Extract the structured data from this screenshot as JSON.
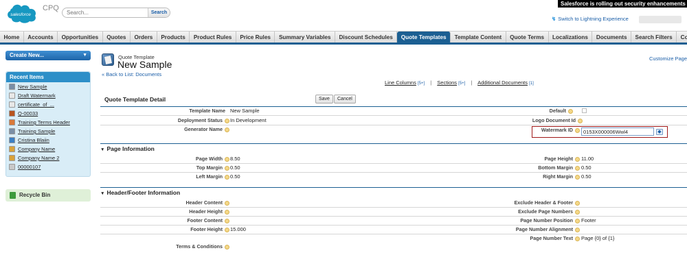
{
  "header": {
    "logo_text": "salesforce",
    "app_name": "CPQ",
    "search_placeholder": "Search...",
    "search_button": "Search",
    "banner": "Salesforce is rolling out security enhancements that",
    "lightning_link": "Switch to Lightning Experience"
  },
  "tabs": [
    {
      "label": "Home",
      "active": false
    },
    {
      "label": "Accounts",
      "active": false
    },
    {
      "label": "Opportunities",
      "active": false
    },
    {
      "label": "Quotes",
      "active": false
    },
    {
      "label": "Orders",
      "active": false
    },
    {
      "label": "Products",
      "active": false
    },
    {
      "label": "Product Rules",
      "active": false
    },
    {
      "label": "Price Rules",
      "active": false
    },
    {
      "label": "Summary Variables",
      "active": false
    },
    {
      "label": "Discount Schedules",
      "active": false
    },
    {
      "label": "Quote Templates",
      "active": true
    },
    {
      "label": "Template Content",
      "active": false
    },
    {
      "label": "Quote Terms",
      "active": false
    },
    {
      "label": "Localizations",
      "active": false
    },
    {
      "label": "Documents",
      "active": false
    },
    {
      "label": "Search Filters",
      "active": false
    },
    {
      "label": "Co",
      "active": false
    }
  ],
  "sidebar": {
    "create_new": "Create New...",
    "recent_title": "Recent Items",
    "recent_items": [
      {
        "label": "New Sample",
        "icon": "template-icon",
        "color": "#7a8fa6"
      },
      {
        "label": "Draft Watermark",
        "icon": "document-icon",
        "color": "#e8e8e8"
      },
      {
        "label": "certificate_of_...",
        "icon": "document-icon",
        "color": "#e8e8e8"
      },
      {
        "label": "Q-00033",
        "icon": "quote-icon",
        "color": "#b8541e"
      },
      {
        "label": "Training Terms Header",
        "icon": "template-content-icon",
        "color": "#d97a3a"
      },
      {
        "label": "Training Sample",
        "icon": "template-icon",
        "color": "#7a8fa6"
      },
      {
        "label": "Cristina Blaiin",
        "icon": "contact-icon",
        "color": "#3b7fc4"
      },
      {
        "label": "Company Name",
        "icon": "template-content-icon",
        "color": "#d9a23a"
      },
      {
        "label": "Company Name 2",
        "icon": "template-content-icon",
        "color": "#d9a23a"
      },
      {
        "label": "00000107",
        "icon": "document-icon",
        "color": "#c9c9c9"
      }
    ],
    "recycle_bin": "Recycle Bin"
  },
  "page": {
    "object_type": "Quote Template",
    "title": "New Sample",
    "back_link": "« Back to List: Documents",
    "customize": "Customize Page",
    "related_links": [
      {
        "label": "Line Columns",
        "count": "[5+]"
      },
      {
        "label": "Sections",
        "count": "[5+]"
      },
      {
        "label": "Additional Documents",
        "count": "[1]"
      }
    ]
  },
  "detail": {
    "title": "Quote Template Detail",
    "save": "Save",
    "cancel": "Cancel",
    "fields": {
      "template_name_label": "Template Name",
      "template_name_value": "New Sample",
      "deployment_status_label": "Deployment Status",
      "deployment_status_value": "In Development",
      "generator_name_label": "Generator Name",
      "default_label": "Default",
      "logo_document_label": "Logo Document Id",
      "watermark_label": "Watermark ID",
      "watermark_value": "0153X000006Wwl4"
    }
  },
  "page_information": {
    "title": "Page Information",
    "page_width_label": "Page Width",
    "page_width_value": "8.50",
    "page_height_label": "Page Height",
    "page_height_value": "11.00",
    "top_margin_label": "Top Margin",
    "top_margin_value": "0.50",
    "bottom_margin_label": "Bottom Margin",
    "bottom_margin_value": "0.50",
    "left_margin_label": "Left Margin",
    "left_margin_value": "0.50",
    "right_margin_label": "Right Margin",
    "right_margin_value": "0.50"
  },
  "header_footer": {
    "title": "Header/Footer Information",
    "header_content_label": "Header Content",
    "exclude_hf_label": "Exclude Header & Footer",
    "header_height_label": "Header Height",
    "exclude_page_numbers_label": "Exclude Page Numbers",
    "footer_content_label": "Footer Content",
    "page_number_position_label": "Page Number Position",
    "page_number_position_value": "Footer",
    "footer_height_label": "Footer Height",
    "footer_height_value": "15.000",
    "page_number_alignment_label": "Page Number Alignment",
    "page_number_text_label": "Page Number Text",
    "page_number_text_value": "Page {0} of {1}",
    "terms_label": "Terms & Conditions"
  },
  "colors": {
    "tab_active": "#1b5f92",
    "link": "#1a5ea8",
    "highlight_border": "#a01818",
    "recent_bg": "#d9edf7",
    "recycle_bg": "#dff0d8"
  }
}
